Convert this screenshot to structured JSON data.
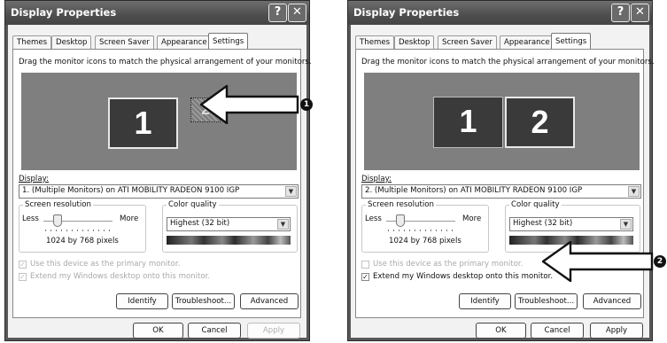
{
  "windows": [
    {
      "title": "Display Properties",
      "help_glyph": "?",
      "close_glyph": "✕",
      "tabs": [
        "Themes",
        "Desktop",
        "Screen Saver",
        "Appearance",
        "Settings"
      ],
      "selected_tab": "Settings",
      "instruction": "Drag the monitor icons to match the physical arrangement of your monitors.",
      "monitors": [
        "1",
        "2"
      ],
      "display_label": "Display:",
      "display_value": "1. (Multiple Monitors) on ATI MOBILITY RADEON 9100 IGP",
      "resolution_group": "Screen resolution",
      "res_less": "Less",
      "res_more": "More",
      "resolution_value": "1024 by 768 pixels",
      "quality_group": "Color quality",
      "quality_value": "Highest (32 bit)",
      "primary_checkbox": "Use this device as the primary monitor.",
      "primary_checked": true,
      "extend_checkbox": "Extend my Windows desktop onto this monitor.",
      "extend_checked": true,
      "btn_identify": "Identify",
      "btn_troubleshoot": "Troubleshoot...",
      "btn_advanced": "Advanced",
      "btn_ok": "OK",
      "btn_cancel": "Cancel",
      "btn_apply": "Apply",
      "callout": "1"
    },
    {
      "title": "Display Properties",
      "help_glyph": "?",
      "close_glyph": "✕",
      "tabs": [
        "Themes",
        "Desktop",
        "Screen Saver",
        "Appearance",
        "Settings"
      ],
      "selected_tab": "Settings",
      "instruction": "Drag the monitor icons to match the physical arrangement of your monitors.",
      "monitors": [
        "1",
        "2"
      ],
      "display_label": "Display:",
      "display_value": "2. (Multiple Monitors) on ATI MOBILITY RADEON 9100 IGP",
      "resolution_group": "Screen resolution",
      "res_less": "Less",
      "res_more": "More",
      "resolution_value": "1024 by 768 pixels",
      "quality_group": "Color quality",
      "quality_value": "Highest (32 bit)",
      "primary_checkbox": "Use this device as the primary monitor.",
      "primary_checked": false,
      "extend_checkbox": "Extend my Windows desktop onto this monitor.",
      "extend_checked": true,
      "btn_identify": "Identify",
      "btn_troubleshoot": "Troubleshoot...",
      "btn_advanced": "Advanced",
      "btn_ok": "OK",
      "btn_cancel": "Cancel",
      "btn_apply": "Apply",
      "callout": "2"
    }
  ]
}
